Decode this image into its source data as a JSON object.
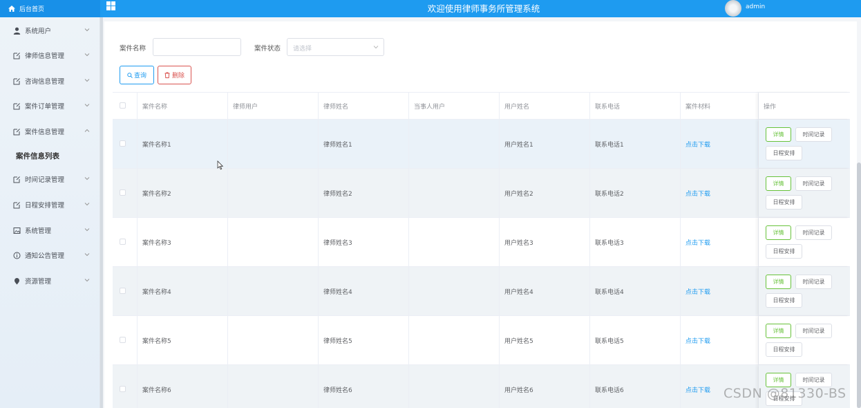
{
  "header": {
    "home_label": "后台首页",
    "system_title": "欢迎使用律师事务所管理系统",
    "user_name": "admin"
  },
  "sidebar": {
    "items": [
      {
        "label": "系统用户",
        "icon": "user-icon",
        "expanded": false
      },
      {
        "label": "律师信息管理",
        "icon": "edit-icon",
        "expanded": false
      },
      {
        "label": "咨询信息管理",
        "icon": "edit-icon",
        "expanded": false
      },
      {
        "label": "案件订单管理",
        "icon": "edit-icon",
        "expanded": false
      },
      {
        "label": "案件信息管理",
        "icon": "edit-icon",
        "expanded": true
      },
      {
        "label": "时间记录管理",
        "icon": "edit-icon",
        "expanded": false
      },
      {
        "label": "日程安排管理",
        "icon": "edit-icon",
        "expanded": false
      },
      {
        "label": "系统管理",
        "icon": "image-icon",
        "expanded": false
      },
      {
        "label": "通知公告管理",
        "icon": "info-icon",
        "expanded": false
      },
      {
        "label": "资源管理",
        "icon": "location-icon",
        "expanded": false
      }
    ],
    "active_subitem": "案件信息列表"
  },
  "filters": {
    "case_name_label": "案件名称",
    "case_name_value": "",
    "case_status_label": "案件状态",
    "case_status_placeholder": "请选择"
  },
  "toolbar": {
    "search_label": "查询",
    "delete_label": "删除"
  },
  "table": {
    "columns": [
      "案件名称",
      "律师用户",
      "律师姓名",
      "当事人用户",
      "用户姓名",
      "联系电话",
      "案件材料",
      "操作"
    ],
    "rows": [
      {
        "case_name": "案件名称1",
        "lawyer_user": "",
        "lawyer_name": "律师姓名1",
        "client_user": "",
        "user_name": "用户姓名1",
        "phone": "联系电话1",
        "material": "点击下载"
      },
      {
        "case_name": "案件名称2",
        "lawyer_user": "",
        "lawyer_name": "律师姓名2",
        "client_user": "",
        "user_name": "用户姓名2",
        "phone": "联系电话2",
        "material": "点击下载"
      },
      {
        "case_name": "案件名称3",
        "lawyer_user": "",
        "lawyer_name": "律师姓名3",
        "client_user": "",
        "user_name": "用户姓名3",
        "phone": "联系电话3",
        "material": "点击下载"
      },
      {
        "case_name": "案件名称4",
        "lawyer_user": "",
        "lawyer_name": "律师姓名4",
        "client_user": "",
        "user_name": "用户姓名4",
        "phone": "联系电话4",
        "material": "点击下载"
      },
      {
        "case_name": "案件名称5",
        "lawyer_user": "",
        "lawyer_name": "律师姓名5",
        "client_user": "",
        "user_name": "用户姓名5",
        "phone": "联系电话5",
        "material": "点击下载"
      },
      {
        "case_name": "案件名称6",
        "lawyer_user": "",
        "lawyer_name": "律师姓名6",
        "client_user": "",
        "user_name": "用户姓名6",
        "phone": "联系电话6",
        "material": "点击下载"
      }
    ],
    "row_actions": {
      "detail_label": "详情",
      "time_label": "时间记录",
      "schedule_label": "日程安排"
    }
  },
  "watermark": "CSDN @81330-BS",
  "colors": {
    "primary": "#1e9bf0",
    "danger": "#d9534f",
    "success": "#67c23a"
  }
}
